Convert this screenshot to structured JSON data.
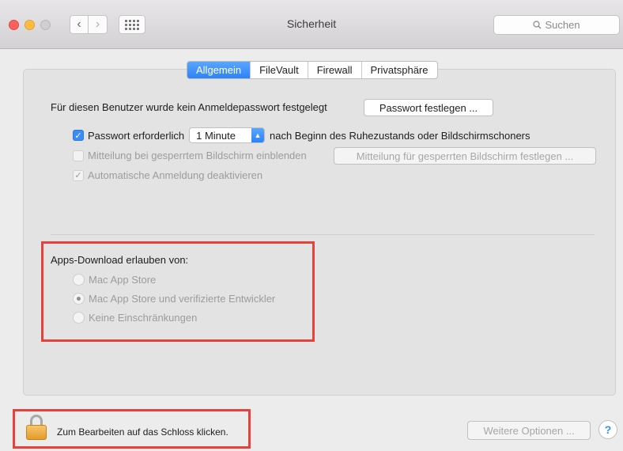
{
  "window": {
    "title": "Sicherheit",
    "search_placeholder": "Suchen"
  },
  "tabs": [
    {
      "label": "Allgemein",
      "active": true
    },
    {
      "label": "FileVault",
      "active": false
    },
    {
      "label": "Firewall",
      "active": false
    },
    {
      "label": "Privatsphäre",
      "active": false
    }
  ],
  "general": {
    "no_password_text": "Für diesen Benutzer wurde kein Anmeldepasswort festgelegt",
    "set_password_button": "Passwort festlegen ...",
    "require_password": {
      "checked": true,
      "label": "Passwort erforderlich",
      "select_value": "1 Minute",
      "suffix": "nach Beginn des Ruhezustands oder Bildschirmschoners"
    },
    "lock_message": {
      "checked": false,
      "label": "Mitteilung bei gesperrtem Bildschirm einblenden",
      "button": "Mitteilung für gesperrten Bildschirm festlegen ..."
    },
    "auto_login": {
      "checked": true,
      "label": "Automatische Anmeldung deaktivieren"
    }
  },
  "apps_download": {
    "title": "Apps-Download erlauben von:",
    "options": [
      {
        "label": "Mac App Store",
        "selected": false
      },
      {
        "label": "Mac App Store und verifizierte Entwickler",
        "selected": true
      },
      {
        "label": "Keine Einschränkungen",
        "selected": false
      }
    ]
  },
  "footer": {
    "lock_text": "Zum Bearbeiten auf das Schloss klicken.",
    "more_options_button": "Weitere Optionen ...",
    "help_label": "?"
  },
  "colors": {
    "accent": "#2d82f7",
    "highlight": "#e8403a"
  }
}
